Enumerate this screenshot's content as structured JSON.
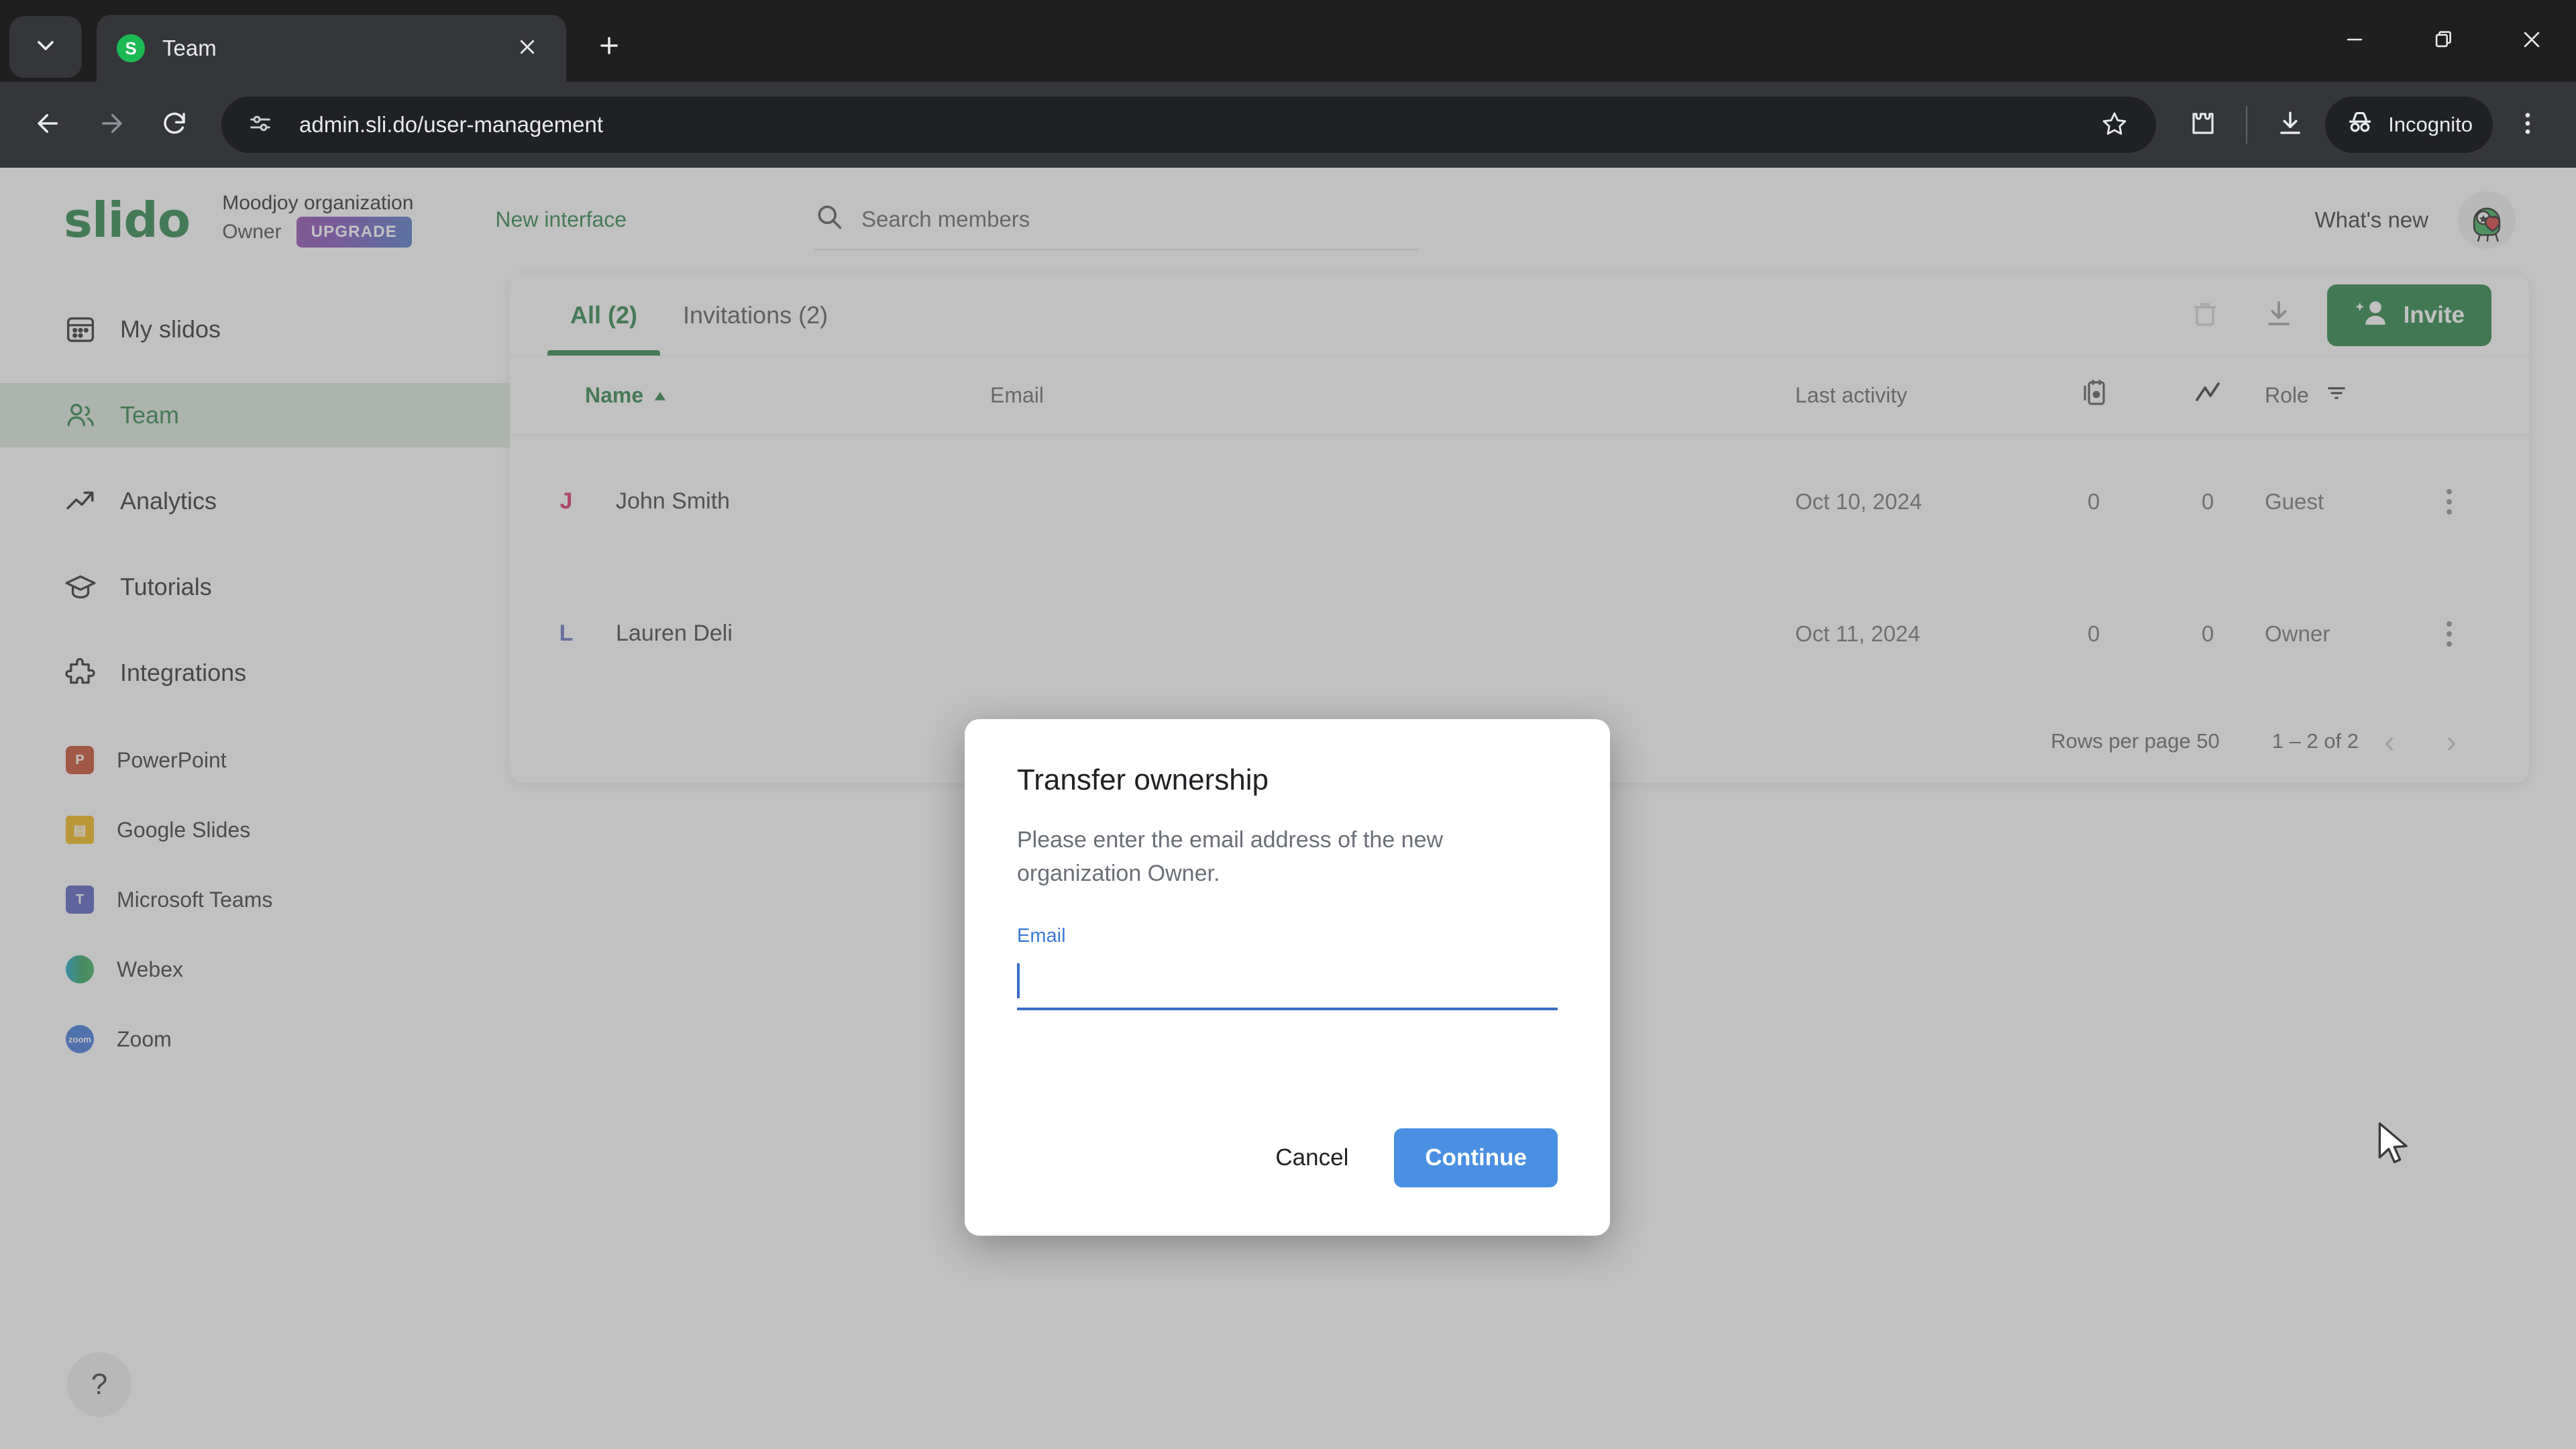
{
  "browser": {
    "tab": {
      "title": "Team",
      "favicon_letter": "S"
    },
    "new_tab_label": "+",
    "url": "admin.sli.do/user-management",
    "profile_label": "Incognito",
    "icons": {
      "tab_search": "chevron-down-icon",
      "tab_close": "close-icon",
      "new_tab": "plus-icon",
      "back": "back-arrow-icon",
      "forward": "forward-arrow-icon",
      "reload": "reload-icon",
      "site_info": "page-settings-icon",
      "bookmark": "star-icon",
      "extensions": "extensions-icon",
      "downloads": "download-icon",
      "incognito": "incognito-icon",
      "menu": "three-dot-menu-icon",
      "minimize": "minimize-icon",
      "maximize": "maximize-icon",
      "close_window": "close-window-icon"
    }
  },
  "header": {
    "logo": "slido",
    "org_name": "Moodjoy organization",
    "org_role": "Owner",
    "upgrade_label": "UPGRADE",
    "new_interface_label": "New interface",
    "search_placeholder": "Search members",
    "whats_new_label": "What's new",
    "avatar_name": "user-avatar"
  },
  "sidebar": {
    "items": [
      {
        "label": "My slidos",
        "icon": "calendar-icon",
        "active": false
      },
      {
        "label": "Team",
        "icon": "people-icon",
        "active": true
      },
      {
        "label": "Analytics",
        "icon": "trend-up-icon",
        "active": false
      },
      {
        "label": "Tutorials",
        "icon": "graduation-cap-icon",
        "active": false
      },
      {
        "label": "Integrations",
        "icon": "puzzle-piece-icon",
        "active": false
      }
    ],
    "integrations": [
      {
        "label": "PowerPoint",
        "icon": "powerpoint-icon",
        "color": "#c43e1c"
      },
      {
        "label": "Google Slides",
        "icon": "google-slides-icon",
        "color": "#f4b400"
      },
      {
        "label": "Microsoft Teams",
        "icon": "microsoft-teams-icon",
        "color": "#4b53bc"
      },
      {
        "label": "Webex",
        "icon": "webex-icon",
        "color": "#00a0d1"
      },
      {
        "label": "Zoom",
        "icon": "zoom-icon",
        "color": "#2d8cff"
      }
    ],
    "help_label": "?"
  },
  "main": {
    "tabs": [
      {
        "label": "All (2)",
        "active": true
      },
      {
        "label": "Invitations (2)",
        "active": false
      }
    ],
    "toolbar": {
      "delete_icon": "delete-icon",
      "export_icon": "download-export-icon",
      "invite_label": "Invite",
      "invite_icon": "add-person-icon"
    },
    "table": {
      "headers": {
        "name": "Name",
        "email": "Email",
        "last_activity": "Last activity",
        "events_icon": "events-icon",
        "analytics_icon": "trend-up-icon",
        "role": "Role",
        "filter_icon": "filter-icon",
        "sort_icon": "sort-ascending-icon"
      },
      "rows": [
        {
          "initial": "J",
          "initial_color": "#d81b60",
          "name": "John Smith",
          "email": "",
          "last_activity": "Oct 10, 2024",
          "events": "0",
          "analytics": "0",
          "role": "Guest"
        },
        {
          "initial": "L",
          "initial_color": "#5c6bc0",
          "name": "Lauren Deli",
          "email": "",
          "last_activity": "Oct 11, 2024",
          "events": "0",
          "analytics": "0",
          "role": "Owner"
        }
      ]
    },
    "pagination": {
      "rows_per_page_label": "Rows per page 50",
      "range_label": "1 – 2 of 2",
      "prev_arrow": "‹",
      "next_arrow": "›"
    }
  },
  "modal": {
    "title": "Transfer ownership",
    "description": "Please enter the email address of the new organization Owner.",
    "email_label": "Email",
    "email_value": "",
    "cancel_label": "Cancel",
    "continue_label": "Continue",
    "accent_color": "#4a90e2"
  }
}
